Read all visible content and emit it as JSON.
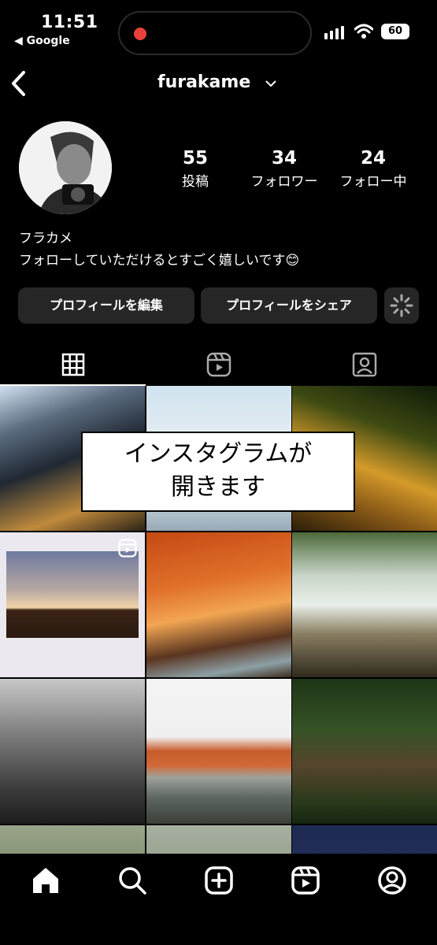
{
  "status_bar": {
    "time": "11:51",
    "back_app": "◀ Google",
    "battery": "60"
  },
  "header": {
    "username": "furakame"
  },
  "profile": {
    "stats": [
      {
        "value": "55",
        "label": "投稿"
      },
      {
        "value": "34",
        "label": "フォロワー"
      },
      {
        "value": "24",
        "label": "フォロー中"
      }
    ],
    "name": "フラカメ",
    "bio": "フォローしていただけるとすごく嬉しいです😊"
  },
  "buttons": {
    "edit": "プロフィールを編集",
    "share": "プロフィールをシェア"
  },
  "tabs": [
    "grid-icon",
    "reels-icon",
    "tagged-icon"
  ],
  "overlay": {
    "line1": "インスタグラムが",
    "line2": "開きます"
  },
  "nav": [
    "home-icon",
    "search-icon",
    "create-icon",
    "reels-icon",
    "profile-icon"
  ],
  "colors": {
    "background": "#000000",
    "button": "#262626",
    "record": "#e8413b"
  }
}
